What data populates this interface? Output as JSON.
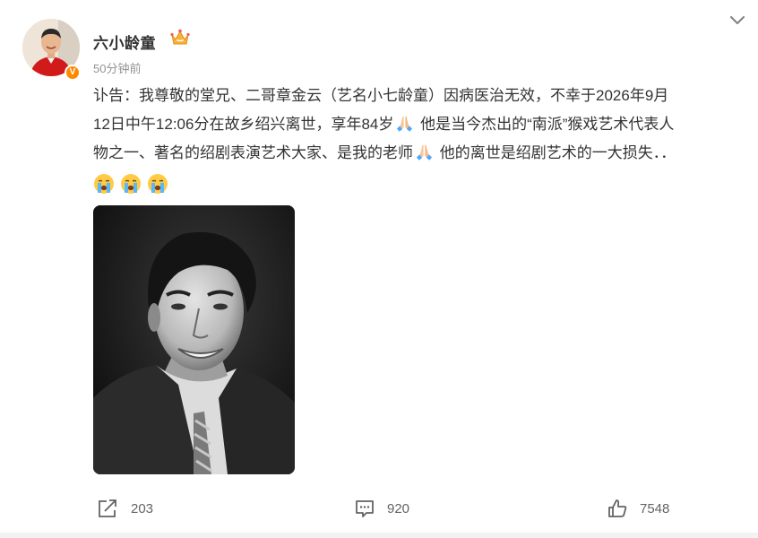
{
  "post": {
    "author": {
      "name": "六小龄童",
      "verified_badge": "V"
    },
    "timestamp": "50分钟前",
    "text_line1": "讣告：我尊敬的堂兄、二哥章金云（艺名小七龄童）因病医治无效，不幸于2026年9月",
    "text_line2a": "12日中午12:06分在故乡绍兴离世，享年84岁",
    "text_line2b": " 他是当今杰出的“南派”猴戏艺术代表人",
    "text_line3a": "物之一、著名的绍剧表演艺术大家、是我的老师",
    "text_line3b": " 他的离世是绍剧艺术的一大损失．．",
    "icons": {
      "pray": "pray-icon",
      "cry": "crying-face-icon",
      "crown": "crown-icon",
      "collapse": "chevron-down-icon"
    }
  },
  "actions": {
    "repost_count": "203",
    "comment_count": "920",
    "like_count": "7548"
  },
  "colors": {
    "badge": "#ff8a00",
    "text": "#333333",
    "muted": "#939393",
    "action": "#636363"
  }
}
